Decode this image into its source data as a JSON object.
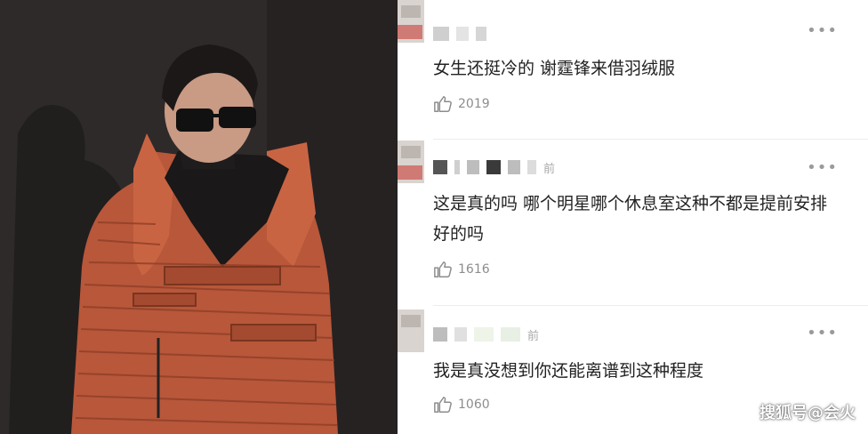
{
  "colors": {
    "background_dark": "#2c2828",
    "jacket_orange": "#c45d3e",
    "text": "#222222",
    "meta_gray": "#8d8d8d"
  },
  "comments": [
    {
      "username": "",
      "time": "",
      "text": "女生还挺冷的 谢霆锋来借羽绒服",
      "likes": "2019",
      "like_icon": "thumb-up-icon",
      "more_icon": "more-dots-icon"
    },
    {
      "username": "",
      "time": "前",
      "text": "这是真的吗 哪个明星哪个休息室这种不都是提前安排好的吗",
      "likes": "1616",
      "like_icon": "thumb-up-icon",
      "more_icon": "more-dots-icon"
    },
    {
      "username": "",
      "time": "前",
      "text": "我是真没想到你还能离谱到这种程度",
      "likes": "1060",
      "like_icon": "thumb-up-icon",
      "more_icon": "more-dots-icon"
    }
  ],
  "watermark": "搜狐号@会火"
}
